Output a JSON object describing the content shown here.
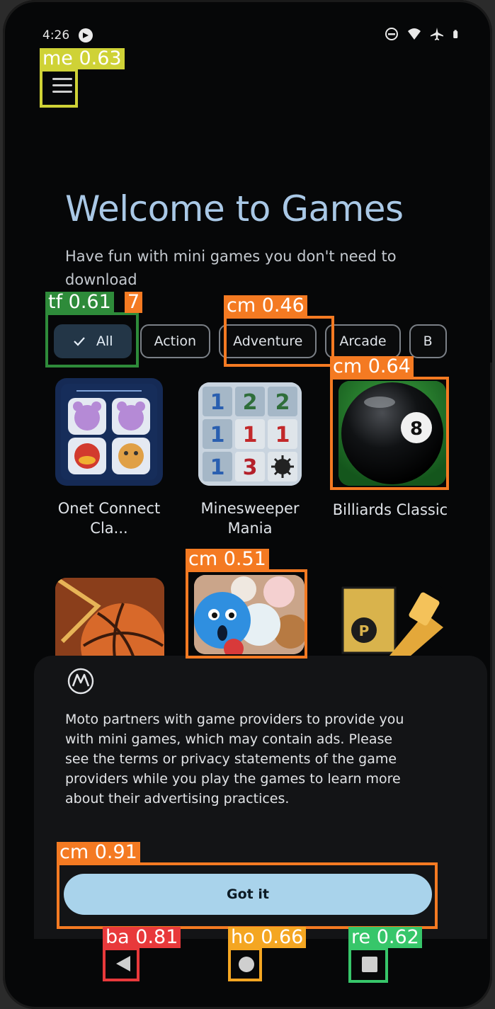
{
  "status_bar": {
    "time": "4:26"
  },
  "header": {
    "title": "Welcome to Games",
    "subtitle": "Have fun with mini games you don't need to download"
  },
  "categories": [
    {
      "label": "All",
      "selected": true
    },
    {
      "label": "Action",
      "selected": false
    },
    {
      "label": "Adventure",
      "selected": false
    },
    {
      "label": "Arcade",
      "selected": false
    },
    {
      "label": "B",
      "selected": false
    }
  ],
  "games": [
    {
      "name": "Onet Connect Cla..."
    },
    {
      "name": "Minesweeper Mania"
    },
    {
      "name": "Billiards Classic"
    }
  ],
  "minesweeper_grid": [
    "1",
    "2",
    "2",
    "1",
    "1",
    "1",
    "1",
    "3",
    ""
  ],
  "billiards_ball_number": "8",
  "notice": {
    "text": "Moto partners with game providers to provide you with mini games, which may contain ads. Please see the terms or privacy statements of the game providers while you play the games to learn more about their advertising practices.",
    "button_label": "Got it"
  },
  "detections": [
    {
      "label": "me 0.63",
      "color": "#cfd236"
    },
    {
      "label": "tf 0.61",
      "color": "#2e8b3a",
      "extra": "7"
    },
    {
      "label": "cm 0.46",
      "color": "#f47a22"
    },
    {
      "label": "cm 0.64",
      "color": "#f47a22"
    },
    {
      "label": "cm 0.51",
      "color": "#f47a22"
    },
    {
      "label": "cm 0.91",
      "color": "#f47a22"
    },
    {
      "label": "ba 0.81",
      "color": "#e8393b"
    },
    {
      "label": "ho 0.66",
      "color": "#f4a622"
    },
    {
      "label": "re 0.62",
      "color": "#37c66a"
    }
  ]
}
